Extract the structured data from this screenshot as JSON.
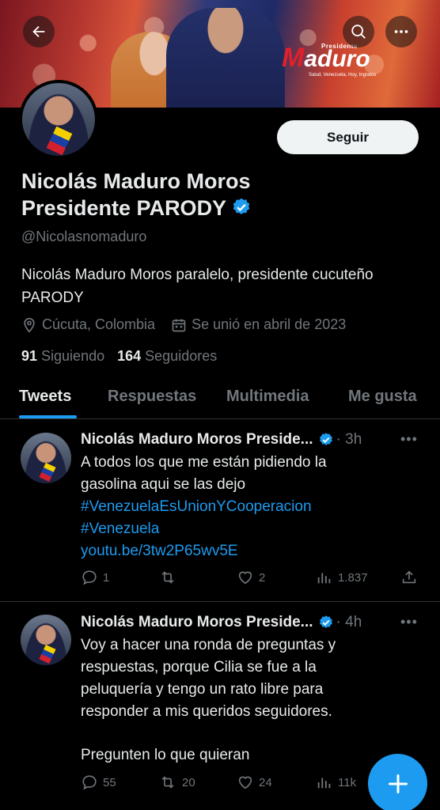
{
  "header": {
    "brand": {
      "sup": "Presidente",
      "m": "M",
      "rest": "aduro",
      "tag": "Salud, Venezuela, Hoy, Ingratos"
    }
  },
  "profile": {
    "follow_label": "Seguir",
    "name_line1": "Nicolás Maduro Moros",
    "name_line2": "Presidente PARODY",
    "handle": "@Nicolasnomaduro",
    "bio": "Nicolás Maduro Moros paralelo, presidente cucuteño PARODY",
    "location": "Cúcuta, Colombia",
    "joined": "Se unió en abril de 2023",
    "following_count": "91",
    "following_label": "Siguiendo",
    "followers_count": "164",
    "followers_label": "Seguidores"
  },
  "tabs": [
    {
      "label": "Tweets",
      "active": true
    },
    {
      "label": "Respuestas",
      "active": false
    },
    {
      "label": "Multimedia",
      "active": false
    },
    {
      "label": "Me gusta",
      "active": false
    }
  ],
  "tweets": [
    {
      "author": "Nicolás Maduro Moros Preside...",
      "time": "· 3h",
      "text_lines": [
        "A todos los que me están pidiendo la",
        "gasolina aqui se las dejo"
      ],
      "links": [
        "#VenezuelaEsUnionYCooperacion",
        "#Venezuela",
        "youtu.be/3tw2P65wv5E"
      ],
      "replies": "1",
      "retweets": "",
      "likes": "2",
      "views": "1.837"
    },
    {
      "author": "Nicolás Maduro Moros Preside...",
      "time": "· 4h",
      "text_lines": [
        "Voy a hacer una ronda de preguntas y",
        "respuestas, porque Cilia se fue a la",
        "peluquería y tengo un rato libre para",
        "responder a mis queridos seguidores."
      ],
      "text_last": "Pregunten lo que quieran",
      "replies": "55",
      "retweets": "20",
      "likes": "24",
      "views": "11k"
    }
  ],
  "colors": {
    "accent": "#1d9bf0",
    "text": "#e7e9ea",
    "muted": "#71767b",
    "background": "#000000"
  },
  "icons": [
    "back-arrow-icon",
    "search-icon",
    "more-icon",
    "verified-icon",
    "location-icon",
    "calendar-icon",
    "reply-icon",
    "retweet-icon",
    "like-icon",
    "views-icon",
    "share-icon",
    "compose-plus-icon"
  ]
}
